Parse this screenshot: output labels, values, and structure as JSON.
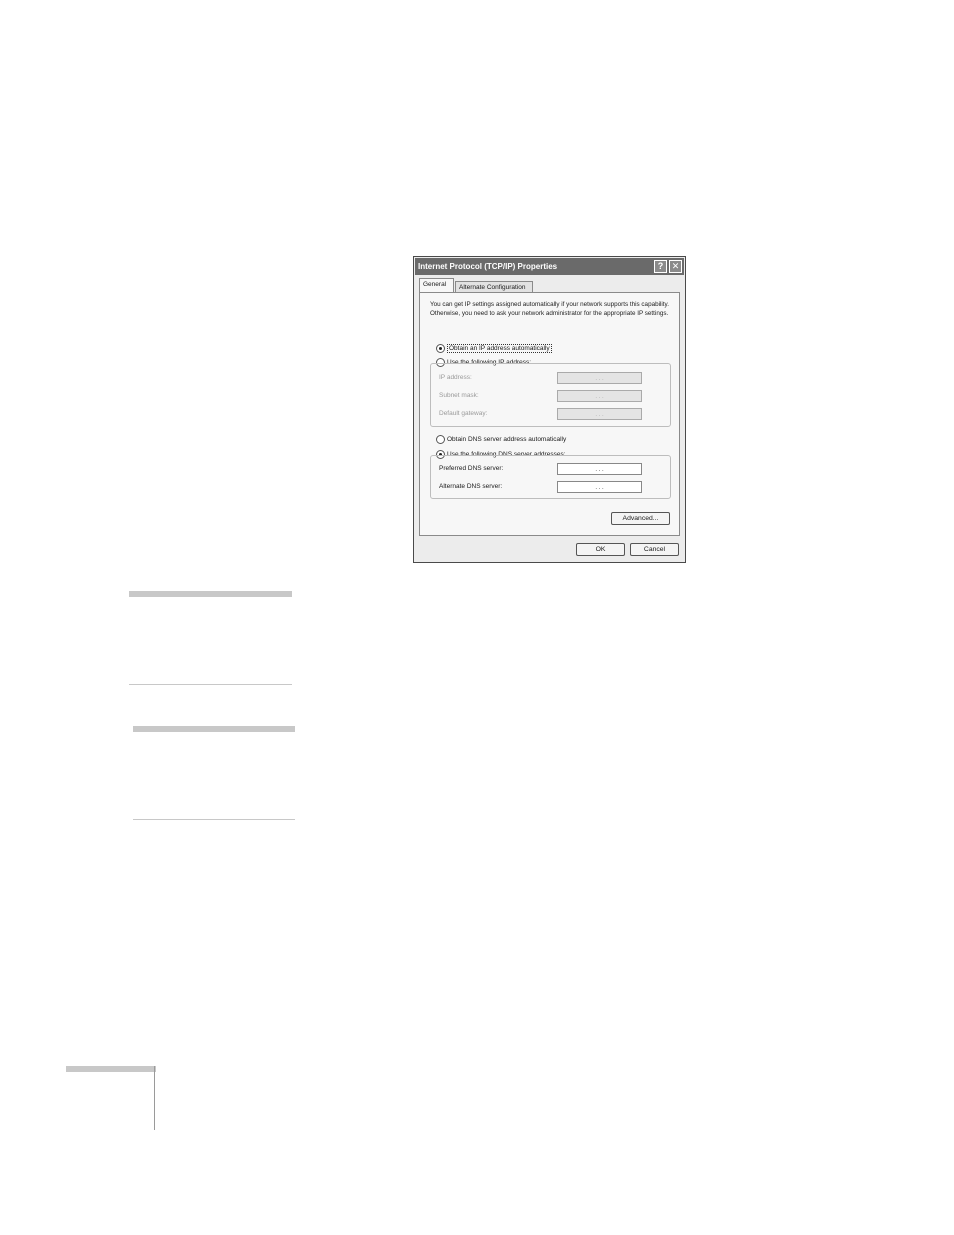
{
  "dialog": {
    "title": "Internet Protocol (TCP/IP) Properties",
    "help_icon": "?",
    "close_icon": "✕",
    "tabs": [
      {
        "label": "General",
        "active": true
      },
      {
        "label": "Alternate Configuration",
        "active": false
      }
    ],
    "description": "You can get IP settings assigned automatically if your network supports this capability. Otherwise, you need to ask your network administrator for the appropriate IP settings.",
    "ip_options": {
      "auto_label": "Obtain an IP address automatically",
      "manual_label": "Use the following IP address:",
      "selected": "auto"
    },
    "ip_fields": [
      {
        "label": "IP address:",
        "value": ". . ."
      },
      {
        "label": "Subnet mask:",
        "value": ". . ."
      },
      {
        "label": "Default gateway:",
        "value": ". . ."
      }
    ],
    "dns_options": {
      "auto_label": "Obtain DNS server address automatically",
      "manual_label": "Use the following DNS server addresses:",
      "selected": "manual"
    },
    "dns_fields": [
      {
        "label": "Preferred DNS server:",
        "value": ". . ."
      },
      {
        "label": "Alternate DNS server:",
        "value": ". . ."
      }
    ],
    "buttons": {
      "advanced": "Advanced...",
      "ok": "OK",
      "cancel": "Cancel"
    }
  }
}
